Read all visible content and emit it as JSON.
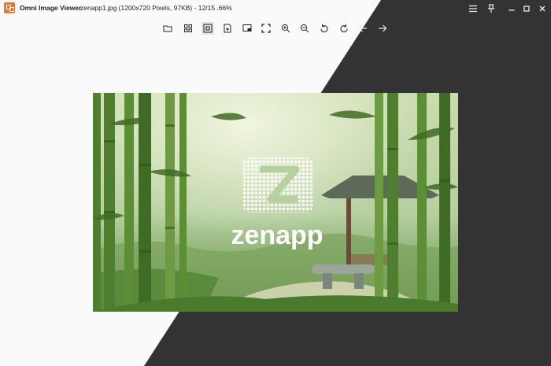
{
  "window": {
    "app_name": "Omni Image Viewer",
    "file_info": "zenapp1.jpg (1200x720 Pixels, 97KB) -  12/15 .66%"
  },
  "controls": {
    "menu_icon": "hamburger-menu-icon",
    "pin_icon": "pin-icon",
    "minimize_icon": "minimize-icon",
    "maximize_icon": "maximize-icon",
    "close_icon": "close-icon"
  },
  "toolbar": {
    "icons": [
      "open-folder-icon",
      "grid-view-icon",
      "fit-screen-icon",
      "add-image-icon",
      "slideshow-icon",
      "fullscreen-icon",
      "zoom-in-icon",
      "zoom-out-icon",
      "rotate-left-icon",
      "rotate-right-icon",
      "previous-arrow-icon",
      "next-arrow-icon"
    ],
    "active_icon": "fit-screen-icon"
  },
  "image": {
    "brand_text": "zenapp",
    "description_colors": {
      "foliage": "#6f9a58",
      "sky": "#d9e8cf"
    }
  },
  "colors": {
    "light_bg": "#fafafa",
    "dark_bg": "#333333",
    "accent_icon": "#e8742e"
  }
}
